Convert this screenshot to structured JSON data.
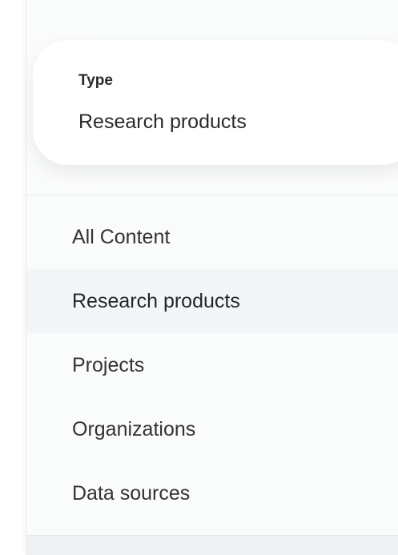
{
  "filter": {
    "label": "Type",
    "value": "Research products"
  },
  "menu": {
    "items": [
      {
        "label": "All Content",
        "active": false
      },
      {
        "label": "Research products",
        "active": true
      },
      {
        "label": "Projects",
        "active": false
      },
      {
        "label": "Organizations",
        "active": false
      },
      {
        "label": "Data sources",
        "active": false
      }
    ]
  }
}
